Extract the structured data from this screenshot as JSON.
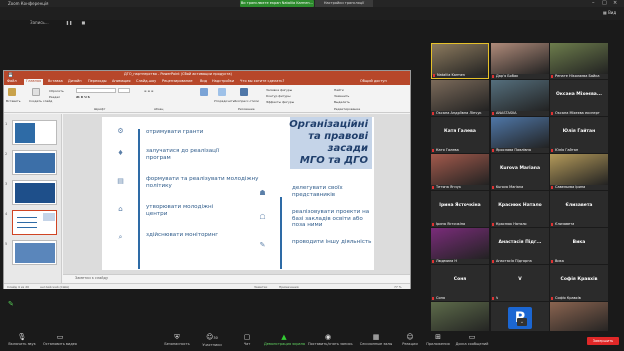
{
  "window": {
    "title": "Zoom Конференція"
  },
  "share": {
    "notice": "Ви транслюєте екран Nataliia Karmen...",
    "settings": "Настройки трансляції",
    "mini": "Запись..."
  },
  "view_label": "Вид",
  "ppt": {
    "title": "ДГО_партнерство - PowerPoint (Сбой активации продукта)",
    "tabs": [
      "Файл",
      "Главная",
      "Вставка",
      "Дизайн",
      "Переходы",
      "Анимация",
      "Слайд-шоу",
      "Рецензирование",
      "Вид",
      "Надстройки",
      "Что вы хотите сделать?"
    ],
    "share_label": "Общий доступ",
    "ribbon": [
      "Вставить",
      "Создать слайд",
      "Сбросить",
      "Раздел",
      "Шрифт",
      "Абзац",
      "Упорядочить",
      "Экспресс-стили",
      "Заливка фигуры",
      "Контур фигуры",
      "Эффекты фигуры",
      "Найти",
      "Заменить",
      "Выделить",
      "Рисование",
      "Редактирование"
    ],
    "notes": "Заметки к слайду",
    "status": {
      "slide": "Слайд 4 из 20",
      "lang": "английский (США)",
      "notes": "Заметки",
      "comments": "Примечания",
      "zoom": "77 %"
    },
    "thumb_numbers": [
      "1",
      "2",
      "3",
      "4",
      "5"
    ]
  },
  "slide": {
    "title": [
      "Організаційні",
      "та правові",
      "засади",
      "МГО та ДГО"
    ],
    "left_items": [
      "отримувати гранти",
      "залучатися до реалізації програм",
      "формувати та реалізувати молодіжну політику",
      "утворювати молодіжні центри",
      "здійснювати моніторинг"
    ],
    "right_items": [
      "делегувати своїх представників",
      "реалізовувати проекти на базі закладів освіти або поза ними",
      "проводити іншу діяльність"
    ]
  },
  "participants": [
    {
      "name": "Nataliia Karmen",
      "big": "",
      "photo": "#8c7a5e"
    },
    {
      "name": "Дар'я Бобак",
      "big": "",
      "photo": "#b08b7a"
    },
    {
      "name": "Ренате Ніколаєва Байка",
      "big": "",
      "photo": "#6d7d4c"
    },
    {
      "name": "Оксана Андріївна Лінчук",
      "big": "",
      "photo": "#7b6a5a"
    },
    {
      "name": "ANASTASIIA",
      "big": "",
      "photo": "#556f7d"
    },
    {
      "name": "Оксана Міхеєва експерт",
      "big": "Оксана Міхеєва...",
      "photo": ""
    },
    {
      "name": "Катя Галева",
      "big": "Катя Галева",
      "photo": ""
    },
    {
      "name": "Ярослава Павлівна",
      "big": "",
      "photo": "#4f77a8"
    },
    {
      "name": "Юлія Гайтан",
      "big": "Юлія Гайтан",
      "photo": ""
    },
    {
      "name": "Тетяна Янчук",
      "big": "",
      "photo": "#a35a4c"
    },
    {
      "name": "Kurova Mariana",
      "big": "Kurova Mariana",
      "photo": ""
    },
    {
      "name": "Савельєва Іринa",
      "big": "",
      "photo": "#b49a5a"
    },
    {
      "name": "Ірина Ясточкіна",
      "big": "Ірина Ясточкіна",
      "photo": ""
    },
    {
      "name": "Краснюк Натало",
      "big": "Краснюк Натало",
      "photo": ""
    },
    {
      "name": "Єлизавета",
      "big": "Єлизавета",
      "photo": ""
    },
    {
      "name": "Людмила Н",
      "big": "",
      "photo": "#7a2c7a"
    },
    {
      "name": "Анастасія Підгорна",
      "big": "Анастасія Підг...",
      "photo": ""
    },
    {
      "name": "Вика",
      "big": "Вика",
      "photo": ""
    },
    {
      "name": "Соня",
      "big": "Соня",
      "photo": ""
    },
    {
      "name": "V",
      "big": "V",
      "photo": ""
    },
    {
      "name": "Софія Кравхів",
      "big": "Софія Кравхів",
      "photo": ""
    },
    {
      "name": "Марина Соломко",
      "big": "",
      "photo": "#5d6b4a"
    },
    {
      "name": "Руслана Бондаренко",
      "big": "P",
      "photo": "blue"
    },
    {
      "name": "Ганна Архова",
      "big": "",
      "photo": "#8a6450"
    }
  ],
  "toolbar": {
    "items": [
      "Включить звук",
      "Остановить видео",
      "Безопасность",
      "Участники",
      "Чат",
      "Демонстрация экрана",
      "Поставить/снять запись",
      "Сессионные залы",
      "Реакции",
      "Приложения",
      "Доска сообщений"
    ],
    "participants_count": "30",
    "end": "Завершить"
  }
}
